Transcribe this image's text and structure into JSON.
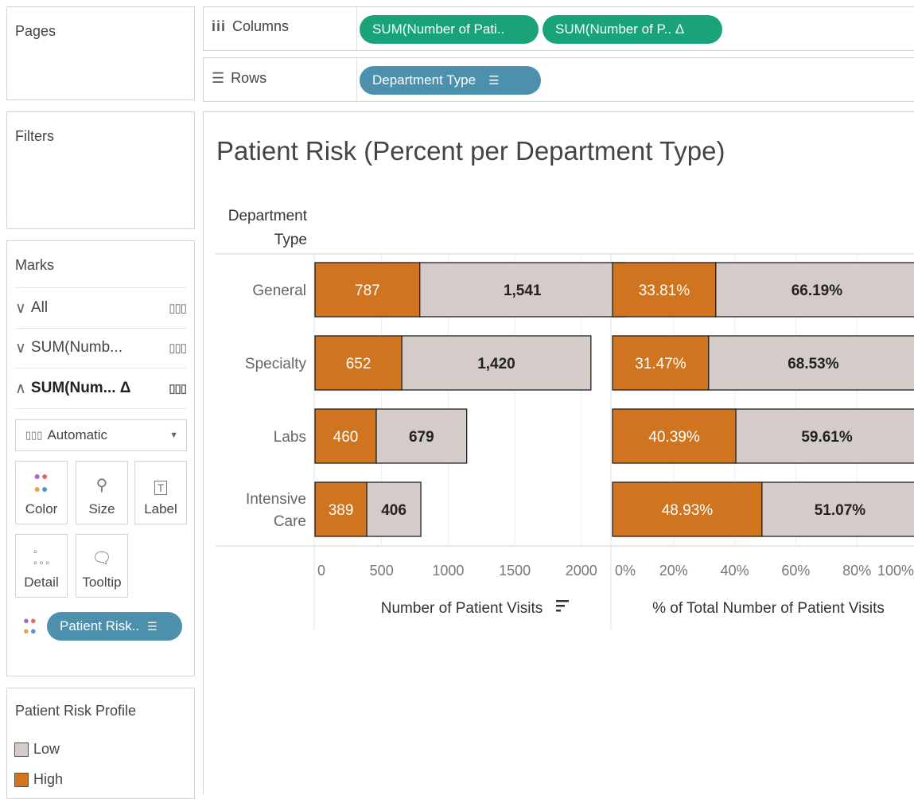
{
  "pages": {
    "title": "Pages"
  },
  "filters": {
    "title": "Filters"
  },
  "columns_shelf": {
    "label": "Columns",
    "pills": [
      "SUM(Number of Pati..",
      "SUM(Number of P.. Δ"
    ]
  },
  "rows_shelf": {
    "label": "Rows",
    "pill": "Department Type"
  },
  "marks": {
    "title": "Marks",
    "rows": [
      "All",
      "SUM(Numb...",
      "SUM(Num... Δ"
    ],
    "mark_type": "Automatic",
    "cards": [
      "Color",
      "Size",
      "Label",
      "Detail",
      "Tooltip"
    ],
    "color_pill": "Patient Risk.."
  },
  "legend": {
    "title": "Patient Risk Profile",
    "items": [
      {
        "label": "Low",
        "color": "#d5ccc9"
      },
      {
        "label": "High",
        "color": "#d1741f"
      }
    ]
  },
  "view": {
    "title": "Patient Risk (Percent per Department Type)",
    "row_header": [
      "Department",
      "Type"
    ]
  },
  "colors": {
    "high": "#d1741f",
    "low": "#d5ccc9",
    "green_pill": "#1aa37a",
    "blue_pill": "#4c90ad"
  },
  "chart_data": [
    {
      "type": "bar",
      "orientation": "horizontal",
      "stacked": true,
      "categories": [
        "General",
        "Specialty",
        "Labs",
        "Intensive Care"
      ],
      "category_labels": [
        [
          "General"
        ],
        [
          "Specialty"
        ],
        [
          "Labs"
        ],
        [
          "Intensive",
          "Care"
        ]
      ],
      "series": [
        {
          "name": "High",
          "values": [
            787,
            652,
            460,
            389
          ],
          "labels": [
            "787",
            "652",
            "460",
            "389"
          ]
        },
        {
          "name": "Low",
          "values": [
            1541,
            1420,
            679,
            406
          ],
          "labels": [
            "1,541",
            "1,420",
            "679",
            "406"
          ]
        }
      ],
      "xlabel": "Number of Patient Visits",
      "xlim": [
        0,
        2300
      ],
      "ticks": [
        0,
        500,
        1000,
        1500,
        2000
      ],
      "tick_labels": [
        "0",
        "500",
        "1000",
        "1500",
        "2000"
      ]
    },
    {
      "type": "bar",
      "orientation": "horizontal",
      "stacked": true,
      "categories": [
        "General",
        "Specialty",
        "Labs",
        "Intensive Care"
      ],
      "series": [
        {
          "name": "High",
          "values": [
            33.81,
            31.47,
            40.39,
            48.93
          ],
          "labels": [
            "33.81%",
            "31.47%",
            "40.39%",
            "48.93%"
          ]
        },
        {
          "name": "Low",
          "values": [
            66.19,
            68.53,
            59.61,
            51.07
          ],
          "labels": [
            "66.19%",
            "68.53%",
            "59.61%",
            "51.07%"
          ]
        }
      ],
      "xlabel": "% of Total Number of Patient Visits",
      "xlim": [
        0,
        100
      ],
      "ticks": [
        0,
        20,
        40,
        60,
        80,
        100
      ],
      "tick_labels": [
        "0%",
        "20%",
        "40%",
        "60%",
        "80%",
        "100%"
      ]
    }
  ]
}
